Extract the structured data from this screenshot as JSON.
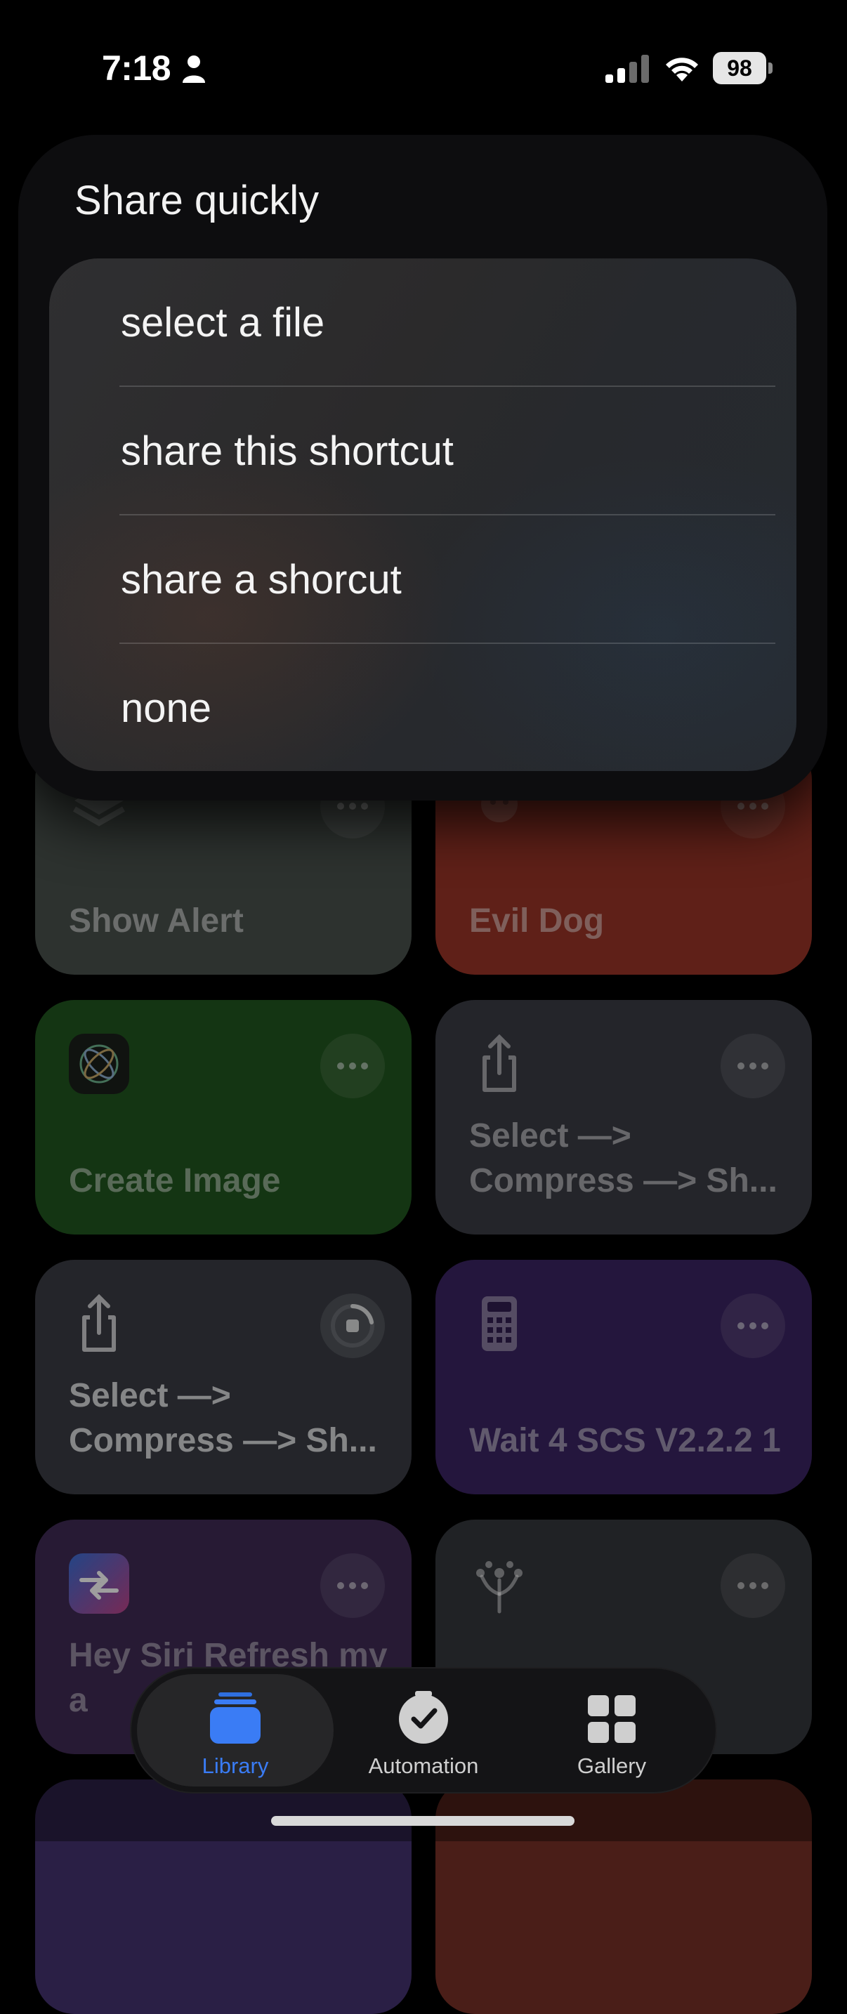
{
  "status_bar": {
    "time": "7:18",
    "battery": "98"
  },
  "modal": {
    "title": "Share quickly",
    "options": [
      "select a file",
      "share this shortcut",
      "share a shorcut",
      "none"
    ]
  },
  "tiles": [
    {
      "title": "Show Alert",
      "color": "#4a524d",
      "icon": "layers-icon"
    },
    {
      "title": "Evil Dog",
      "color": "#9a3527",
      "icon": "dog-icon"
    },
    {
      "title": "Create Image",
      "color": "#21561f",
      "icon": "image-playground-icon"
    },
    {
      "title": "Select —> Compress —> Sh...",
      "color": "#3a3d45",
      "icon": "share-icon"
    },
    {
      "title": "Select —> Compress —> Sh...",
      "color": "#3a3d45",
      "icon": "share-icon"
    },
    {
      "title": "Wait 4 SCS V2.2.2 1",
      "color": "#3b2463",
      "icon": "calculator-icon"
    },
    {
      "title": "Hey Siri Refresh my a",
      "color": "#3f2a55",
      "icon": "shortcuts-app-icon"
    },
    {
      "title": "",
      "color": "#35373c",
      "icon": "sprout-icon"
    }
  ],
  "tabbar": {
    "tabs": [
      {
        "label": "Library",
        "active": true
      },
      {
        "label": "Automation",
        "active": false
      },
      {
        "label": "Gallery",
        "active": false
      }
    ]
  },
  "colors": {
    "accent": "#3a7cf5",
    "background": "#000000"
  }
}
